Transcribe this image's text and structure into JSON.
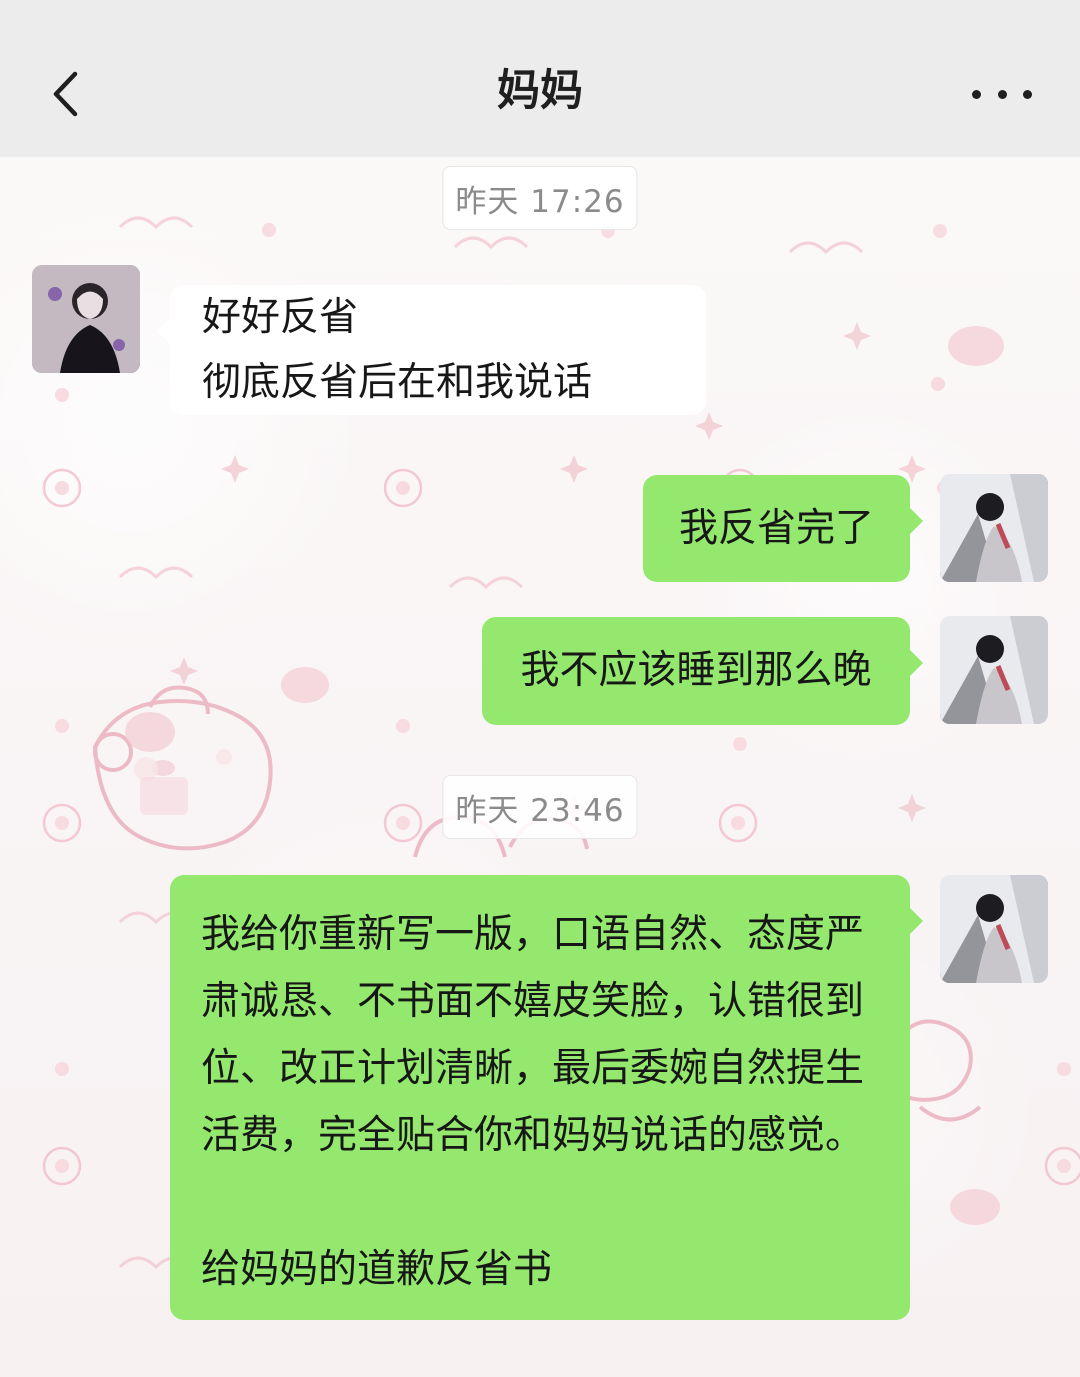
{
  "header": {
    "title": "妈妈"
  },
  "messages": {
    "ts1": "昨天 17:26",
    "m1": "好好反省\n彻底反省后在和我说话",
    "m2": "我反省完了",
    "m3": "我不应该睡到那么晚",
    "ts2": "昨天 23:46",
    "m4": "我给你重新写一版，口语自然、态度严肃诚恳、不书面不嬉皮笑脸，认错很到位、改正计划清晰，最后委婉自然提生活费，完全贴合你和妈妈说话的感觉。\n\n给妈妈的道歉反省书"
  }
}
